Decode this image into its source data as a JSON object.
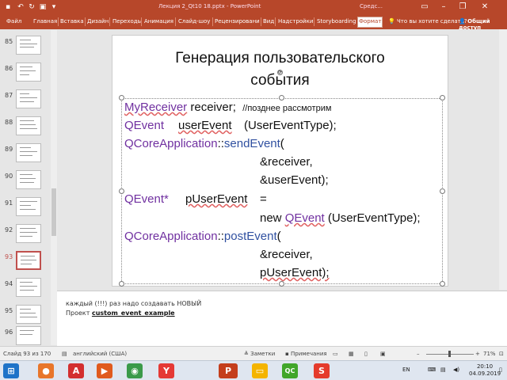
{
  "window": {
    "title": "Лекция 2_Qt10 18.pptx - PowerPoint",
    "context_label": "Средс...",
    "qat_icons": [
      "save-icon",
      "undo-icon",
      "redo-icon",
      "start-slideshow-icon",
      "customize-icon"
    ]
  },
  "ribbon": {
    "tabs": [
      "Файл",
      "Главная",
      "Вставка",
      "Дизайн",
      "Переходы",
      "Анимация",
      "Слайд-шоу",
      "Рецензировани",
      "Вид",
      "Надстройки",
      "Storyboarding",
      "Формат"
    ],
    "selected_tab": "Формат",
    "tell_me": "Что вы хотите сделать?",
    "share": "Общий доступ",
    "accent": "#b7472a"
  },
  "thumbnails": [
    {
      "num": "85"
    },
    {
      "num": "86"
    },
    {
      "num": "87"
    },
    {
      "num": "88"
    },
    {
      "num": "89"
    },
    {
      "num": "90"
    },
    {
      "num": "91"
    },
    {
      "num": "92"
    },
    {
      "num": "93",
      "selected": true
    },
    {
      "num": "94"
    },
    {
      "num": "95"
    },
    {
      "num": "96"
    }
  ],
  "slide": {
    "title_line1": "Генерация пользовательского",
    "title_line2": "события",
    "code": {
      "l1_cls": "MyReceiver",
      "l1_rest": " receiver;  ",
      "l1_comment": "//позднее рассмотрим",
      "l2_cls": "QEvent",
      "l2_var": "userEvent",
      "l2_rest": "(UserEventType);",
      "l3_cls": "QCoreApplication",
      "l3_sep": "::",
      "l3_fn": "sendEvent",
      "l3_paren": "(",
      "l4": "&receiver,",
      "l5": "&userEvent);",
      "l6_cls": "QEvent*",
      "l6_var": "pUserEvent",
      "l6_eq": "=",
      "l7_new": "new ",
      "l7_cls": "QEvent",
      "l7_rest": " (UserEventType);",
      "l8_cls": "QCoreApplication",
      "l8_sep": "::",
      "l8_fn": "postEvent",
      "l8_paren": "(",
      "l9": "&receiver,",
      "l10": "pUserEvent);"
    }
  },
  "notes": {
    "line1": "каждый (!!!) раз надо создавать НОВЫЙ",
    "line2_prefix": "Проект ",
    "line2_link": "custom_event_example"
  },
  "status": {
    "slide_counter": "Слайд 93 из 170",
    "language": "английский (США)",
    "notes_btn": "Заметки",
    "comments_btn": "Примечания",
    "zoom": "71%"
  },
  "taskbar": {
    "apps": [
      {
        "name": "start-icon",
        "glyph": "⊞",
        "color": "#1e73c8"
      },
      {
        "name": "firefox-icon",
        "glyph": "●",
        "color": "#e8762b"
      },
      {
        "name": "acrobat-icon",
        "glyph": "A",
        "color": "#d32f2f"
      },
      {
        "name": "media-player-icon",
        "glyph": "▶",
        "color": "#e05a1e"
      },
      {
        "name": "chrome-icon",
        "glyph": "◉",
        "color": "#3a9a4a"
      },
      {
        "name": "yandex-browser-icon",
        "glyph": "Y",
        "color": "#e53935"
      },
      {
        "name": "powerpoint-icon",
        "glyph": "P",
        "color": "#c43e1c"
      },
      {
        "name": "file-explorer-icon",
        "glyph": "▭",
        "color": "#f4b400"
      },
      {
        "name": "qt-creator-icon",
        "glyph": "QC",
        "color": "#41a62a"
      },
      {
        "name": "screen-recorder-icon",
        "glyph": "S",
        "color": "#e53b2c"
      }
    ],
    "lang": "EN",
    "time": "20:10",
    "date": "04.09.2019"
  }
}
